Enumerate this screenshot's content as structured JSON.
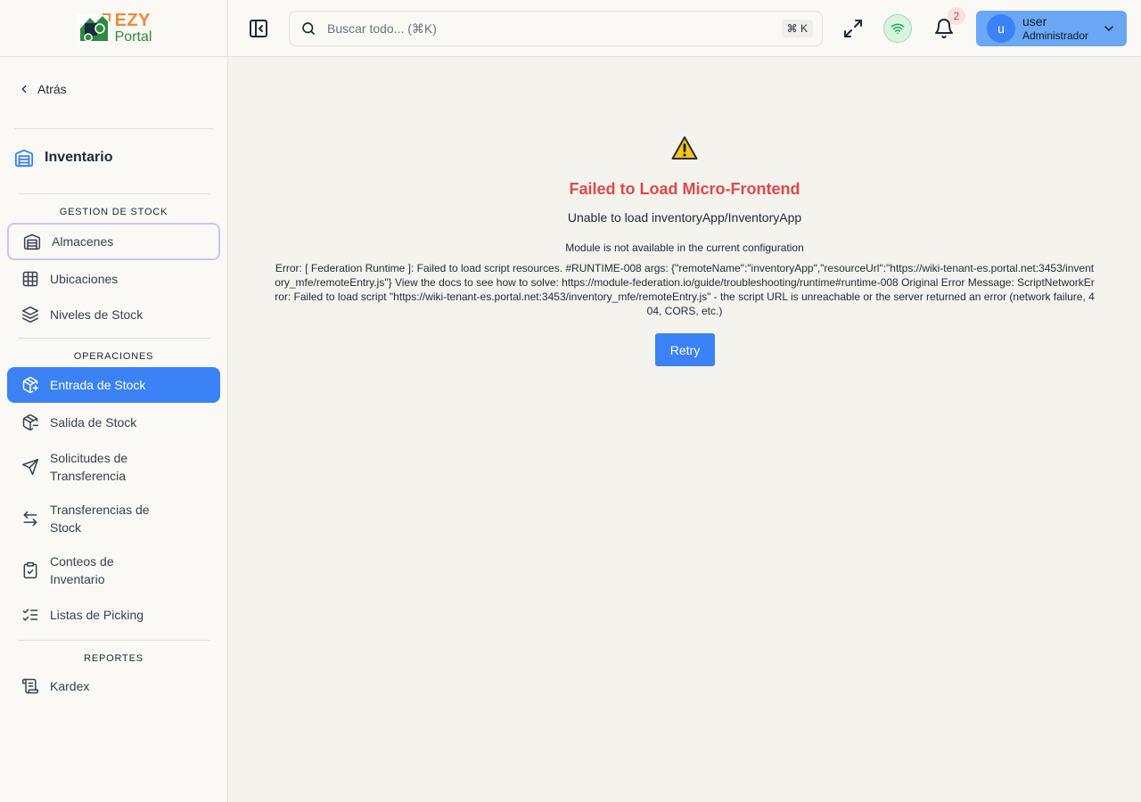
{
  "brand": {
    "logo_top": "EZY",
    "logo_bottom": "Portal",
    "colors": {
      "orange": "#f08a3a",
      "green": "#2f8a3f"
    }
  },
  "sidebar": {
    "back_label": "Atrás",
    "module_label": "Inventario",
    "sections": [
      {
        "title": "GESTION DE STOCK"
      },
      {
        "title": "OPERACIONES"
      },
      {
        "title": "REPORTES"
      }
    ],
    "items": [
      {
        "label": "Almacenes",
        "icon": "warehouse-icon",
        "state": "focused"
      },
      {
        "label": "Ubicaciones",
        "icon": "grid-icon"
      },
      {
        "label": "Niveles de Stock",
        "icon": "layers-icon"
      },
      {
        "label": "Entrada de Stock",
        "icon": "package-plus-icon",
        "state": "active"
      },
      {
        "label": "Salida de Stock",
        "icon": "package-minus-icon"
      },
      {
        "label": "Solicitudes de Transferencia",
        "icon": "send-icon"
      },
      {
        "label": "Transferencias de Stock",
        "icon": "arrows-left-right-icon"
      },
      {
        "label": "Conteos de Inventario",
        "icon": "clipboard-check-icon"
      },
      {
        "label": "Listas de Picking",
        "icon": "list-checks-icon"
      },
      {
        "label": "Kardex",
        "icon": "scroll-icon"
      }
    ],
    "active_color": "#3b82f6"
  },
  "header": {
    "search_placeholder": "Buscar todo... (⌘K)",
    "shortcut": "⌘ K",
    "notifications_count": "2",
    "user_initial": "u",
    "user_name": "user",
    "user_role": "Administrador"
  },
  "error": {
    "title": "Failed to Load Micro-Frontend",
    "subtitle": "Unable to load inventoryApp/InventoryApp",
    "module_message": "Module is not available in the current configuration",
    "detail": "Error: [ Federation Runtime ]: Failed to load script resources. #RUNTIME-008 args: {\"remoteName\":\"inventoryApp\",\"resourceUrl\":\"https://wiki-tenant-es.portal.net:3453/inventory_mfe/remoteEntry.js\"} View the docs to see how to solve: https://module-federation.io/guide/troubleshooting/runtime#runtime-008 Original Error Message: ScriptNetworkError: Failed to load script \"https://wiki-tenant-es.portal.net:3453/inventory_mfe/remoteEntry.js\" - the script URL is unreachable or the server returned an error (network failure, 404, CORS, etc.)",
    "retry_label": "Retry",
    "title_color": "#e04848"
  }
}
